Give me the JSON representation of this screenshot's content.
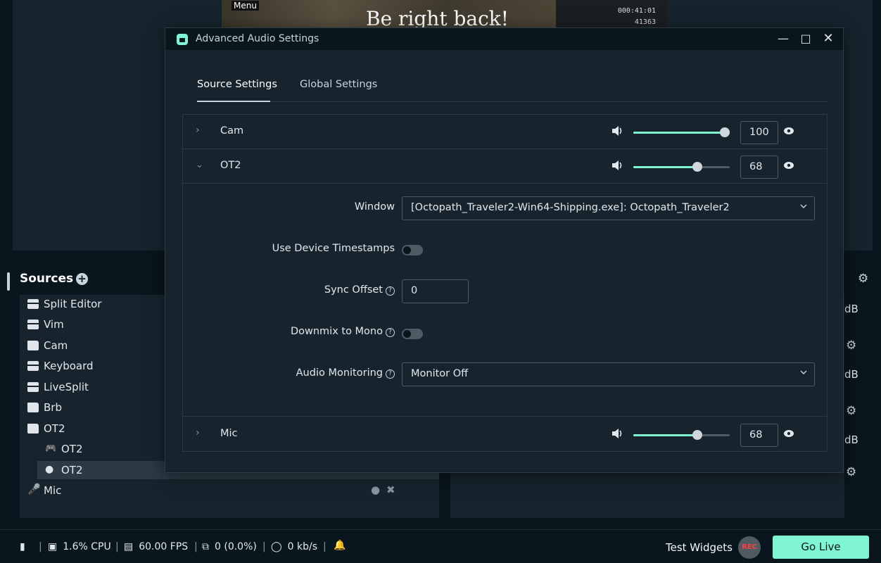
{
  "preview": {
    "menu_label": "Menu",
    "brb_text": "Be right back!",
    "timer": "000:41:01",
    "counter": "41363"
  },
  "sources": {
    "title": "Sources",
    "items": [
      {
        "label": "Split Editor",
        "icon": "window-icon"
      },
      {
        "label": "Vim",
        "icon": "window-icon"
      },
      {
        "label": "Cam",
        "icon": "folder-icon"
      },
      {
        "label": "Keyboard",
        "icon": "window-icon"
      },
      {
        "label": "LiveSplit",
        "icon": "window-icon"
      },
      {
        "label": "Brb",
        "icon": "folder-icon"
      },
      {
        "label": "OT2",
        "icon": "folder-open-icon"
      },
      {
        "label": "OT2",
        "icon": "gamepad-icon"
      },
      {
        "label": "OT2",
        "icon": "user-icon"
      },
      {
        "label": "Mic",
        "icon": "microphone-icon"
      }
    ]
  },
  "mixer": {
    "db_label": "dB"
  },
  "status": {
    "cpu": "1.6% CPU",
    "fps": "60.00 FPS",
    "dropped": "0 (0.0%)",
    "bitrate": "0 kb/s",
    "test_widgets": "Test Widgets",
    "rec": "REC",
    "go_live": "Go Live"
  },
  "modal": {
    "title": "Advanced Audio Settings",
    "tabs": [
      "Source Settings",
      "Global Settings"
    ],
    "sources": [
      {
        "name": "Cam",
        "volume": "100",
        "level": 1.0,
        "expanded": false
      },
      {
        "name": "OT2",
        "volume": "68",
        "level": 0.68,
        "expanded": true
      },
      {
        "name": "Mic",
        "volume": "68",
        "level": 0.68,
        "expanded": false
      }
    ],
    "ot2_settings": {
      "window_label": "Window",
      "window_value": "[Octopath_Traveler2-Win64-Shipping.exe]: Octopath_Traveler2",
      "timestamps_label": "Use Device Timestamps",
      "sync_label": "Sync Offset",
      "sync_value": "0",
      "downmix_label": "Downmix to Mono",
      "monitoring_label": "Audio Monitoring",
      "monitoring_value": "Monitor Off"
    }
  },
  "colors": {
    "accent": "#80f5d2",
    "background": "#09161d",
    "panel": "#17242d",
    "rec": "#fc3e3f"
  }
}
